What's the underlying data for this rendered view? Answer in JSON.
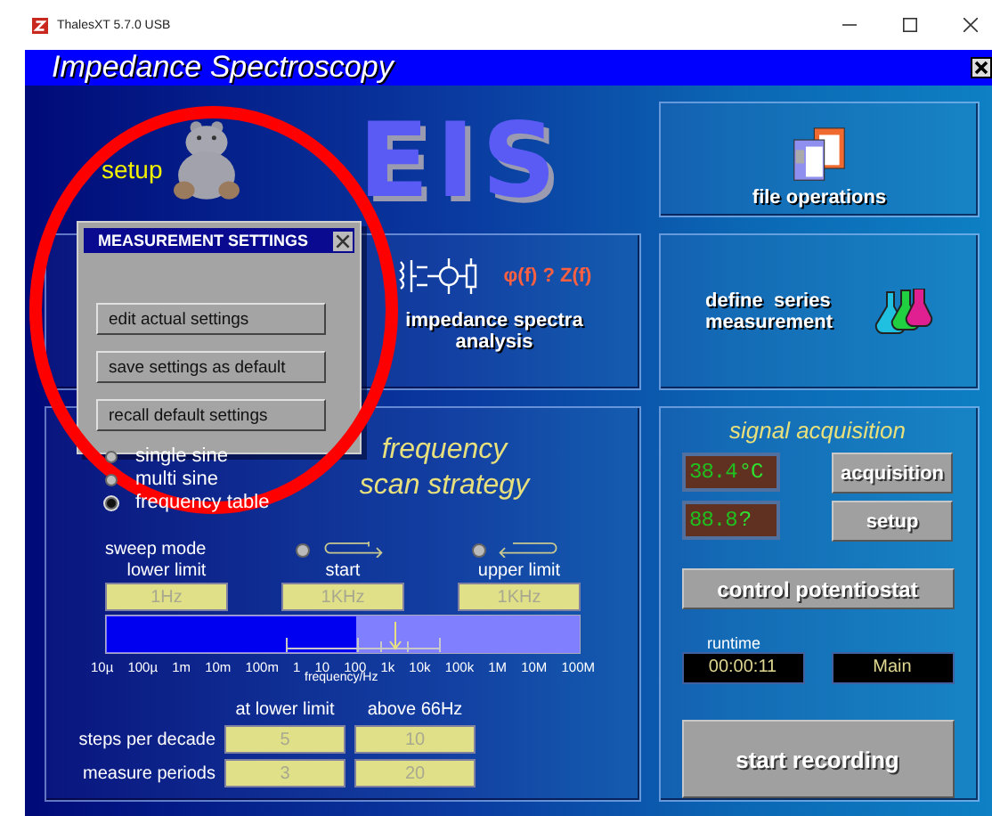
{
  "window": {
    "title": "ThalesXT 5.7.0 USB"
  },
  "app": {
    "title": "Impedance Spectroscopy"
  },
  "setup": {
    "label": "setup"
  },
  "logo": "EIS",
  "file_operations": {
    "label": "file operations"
  },
  "analysis": {
    "formula": "φ(f) ? Z(f)",
    "label": "impedance spectra analysis"
  },
  "series": {
    "label": "define  series measurement"
  },
  "dialog": {
    "title": "MEASUREMENT SETTINGS",
    "buttons": [
      "edit actual settings",
      "save settings as default",
      "recall default settings"
    ]
  },
  "scan": {
    "title": "frequency scan strategy",
    "modes": [
      {
        "label": "single sine",
        "selected": false
      },
      {
        "label": "multi sine",
        "selected": false
      },
      {
        "label": "frequency table",
        "selected": true
      }
    ],
    "sweep_label": "sweep mode",
    "sweep": [
      {
        "kind": "up",
        "selected": false
      },
      {
        "kind": "down",
        "selected": false
      }
    ],
    "limits": [
      {
        "label": "lower limit",
        "value": "1Hz"
      },
      {
        "label": "start",
        "value": "1KHz"
      },
      {
        "label": "upper limit",
        "value": "1KHz"
      }
    ],
    "axis_labels": [
      "10µ",
      "100µ",
      "1m",
      "10m",
      "100m",
      "1",
      "10",
      "100",
      "1k",
      "10k",
      "100k",
      "1M",
      "10M",
      "100M"
    ],
    "axis_title": "frequency/Hz",
    "columns": [
      "at lower limit",
      "above 66Hz"
    ],
    "rows": [
      {
        "label": "steps per decade",
        "values": [
          "5",
          "10"
        ]
      },
      {
        "label": "measure periods",
        "values": [
          "3",
          "20"
        ]
      }
    ]
  },
  "acquisition": {
    "title": "signal acquisition",
    "displays": [
      {
        "reading": "38.4",
        "unit": "°C"
      },
      {
        "reading": "88.8",
        "unit": "?"
      }
    ],
    "buttons": [
      "acquisition",
      "setup"
    ],
    "control": "control potentiostat",
    "runtime_label": "runtime",
    "runtime": "00:00:11",
    "channel": "Main",
    "start": "start recording"
  }
}
